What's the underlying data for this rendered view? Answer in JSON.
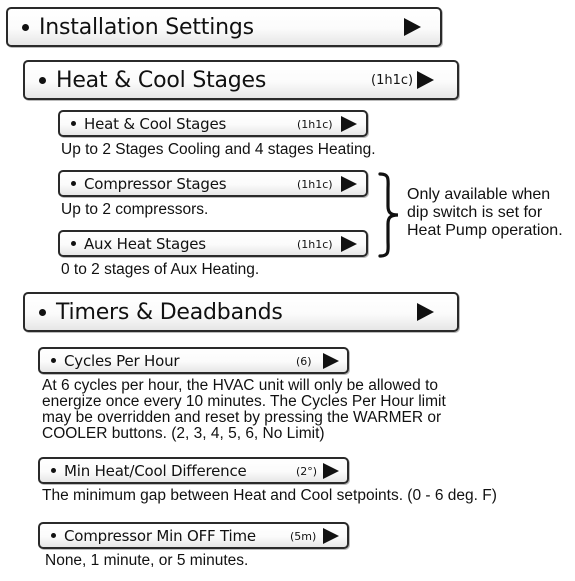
{
  "installation_settings": {
    "label": "Installation Settings",
    "value": "",
    "icon": "play-arrow-icon"
  },
  "heat_cool_section": {
    "label": "Heat & Cool Stages",
    "value": "(1h1c)",
    "icon": "play-arrow-icon",
    "items": [
      {
        "label": "Heat & Cool Stages",
        "value": "(1h1c)",
        "description": "Up to 2 Stages Cooling and 4 stages Heating."
      },
      {
        "label": "Compressor Stages",
        "value": "(1h1c)",
        "description": "Up to 2 compressors."
      },
      {
        "label": "Aux Heat Stages",
        "value": "(1h1c)",
        "description": "0 to 2 stages of Aux Heating."
      }
    ],
    "heat_pump_note": "Only available when\ndip switch is set for\nHeat Pump operation."
  },
  "timers_section": {
    "label": "Timers & Deadbands",
    "value": "",
    "icon": "play-arrow-icon",
    "items": [
      {
        "label": "Cycles Per Hour",
        "value": "(6)",
        "description": "At 6 cycles per hour, the HVAC unit will only be allowed to\nenergize once every 10 minutes. The Cycles Per Hour limit\nmay be overridden and reset by pressing the WARMER or\nCOOLER buttons. (2, 3, 4, 5, 6, No Limit)"
      },
      {
        "label": "Min Heat/Cool Difference",
        "value": "(2°)",
        "description": "The minimum gap between Heat and Cool setpoints. (0 - 6 deg. F)"
      },
      {
        "label": "Compressor Min OFF Time",
        "value": "(5m)",
        "description": "None, 1 minute, or 5 minutes."
      }
    ]
  }
}
